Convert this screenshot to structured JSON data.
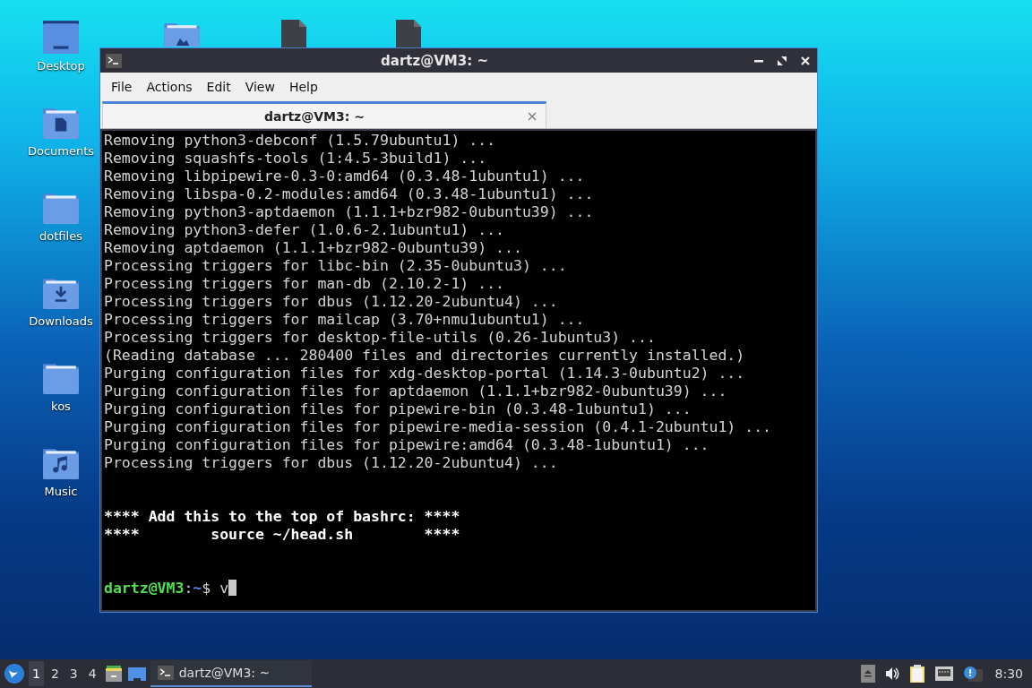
{
  "desktop_icons": [
    {
      "label": "Desktop",
      "kind": "desktop"
    },
    {
      "label": "Documents",
      "kind": "documents"
    },
    {
      "label": "dotfiles",
      "kind": "folder"
    },
    {
      "label": "Downloads",
      "kind": "downloads"
    },
    {
      "label": "kos",
      "kind": "folder"
    },
    {
      "label": "Music",
      "kind": "music"
    }
  ],
  "hidden_icons": [
    {
      "kind": "pictures"
    },
    {
      "kind": "script"
    },
    {
      "kind": "script"
    }
  ],
  "window": {
    "title": "dartz@VM3: ~",
    "menu": [
      "File",
      "Actions",
      "Edit",
      "View",
      "Help"
    ],
    "tabs": [
      {
        "label": "dartz@VM3: ~",
        "selected": true
      }
    ],
    "lines": [
      {
        "kind": "normal",
        "text": "Removing python3-debconf (1.5.79ubuntu1) ..."
      },
      {
        "kind": "normal",
        "text": "Removing squashfs-tools (1:4.5-3build1) ..."
      },
      {
        "kind": "normal",
        "text": "Removing libpipewire-0.3-0:amd64 (0.3.48-1ubuntu1) ..."
      },
      {
        "kind": "normal",
        "text": "Removing libspa-0.2-modules:amd64 (0.3.48-1ubuntu1) ..."
      },
      {
        "kind": "normal",
        "text": "Removing python3-aptdaemon (1.1.1+bzr982-0ubuntu39) ..."
      },
      {
        "kind": "normal",
        "text": "Removing python3-defer (1.0.6-2.1ubuntu1) ..."
      },
      {
        "kind": "normal",
        "text": "Removing aptdaemon (1.1.1+bzr982-0ubuntu39) ..."
      },
      {
        "kind": "normal",
        "text": "Processing triggers for libc-bin (2.35-0ubuntu3) ..."
      },
      {
        "kind": "normal",
        "text": "Processing triggers for man-db (2.10.2-1) ..."
      },
      {
        "kind": "normal",
        "text": "Processing triggers for dbus (1.12.20-2ubuntu4) ..."
      },
      {
        "kind": "normal",
        "text": "Processing triggers for mailcap (3.70+nmu1ubuntu1) ..."
      },
      {
        "kind": "normal",
        "text": "Processing triggers for desktop-file-utils (0.26-1ubuntu3) ..."
      },
      {
        "kind": "normal",
        "text": "(Reading database ... 280400 files and directories currently installed.)"
      },
      {
        "kind": "normal",
        "text": "Purging configuration files for xdg-desktop-portal (1.14.3-0ubuntu2) ..."
      },
      {
        "kind": "normal",
        "text": "Purging configuration files for aptdaemon (1.1.1+bzr982-0ubuntu39) ..."
      },
      {
        "kind": "normal",
        "text": "Purging configuration files for pipewire-bin (0.3.48-1ubuntu1) ..."
      },
      {
        "kind": "normal",
        "text": "Purging configuration files for pipewire-media-session (0.4.1-2ubuntu1) ..."
      },
      {
        "kind": "normal",
        "text": "Purging configuration files for pipewire:amd64 (0.3.48-1ubuntu1) ..."
      },
      {
        "kind": "normal",
        "text": "Processing triggers for dbus (1.12.20-2ubuntu4) ..."
      },
      {
        "kind": "blank"
      },
      {
        "kind": "blank"
      },
      {
        "kind": "bold",
        "text": "**** Add this to the top of bashrc: ****"
      },
      {
        "kind": "bold",
        "text": "****        source ~/head.sh        ****"
      },
      {
        "kind": "blank"
      },
      {
        "kind": "blank"
      },
      {
        "kind": "prompt",
        "user": "dartz@VM3",
        "separator": ":",
        "path": "~",
        "symbol": "$",
        "input": "v"
      }
    ]
  },
  "taskbar": {
    "workspaces": [
      {
        "label": "1",
        "selected": true
      },
      {
        "label": "2",
        "selected": false
      },
      {
        "label": "3",
        "selected": false
      },
      {
        "label": "4",
        "selected": false
      }
    ],
    "tasks": [
      {
        "label": "dartz@VM3: ~",
        "selected": true
      }
    ],
    "clock": "8:30"
  }
}
